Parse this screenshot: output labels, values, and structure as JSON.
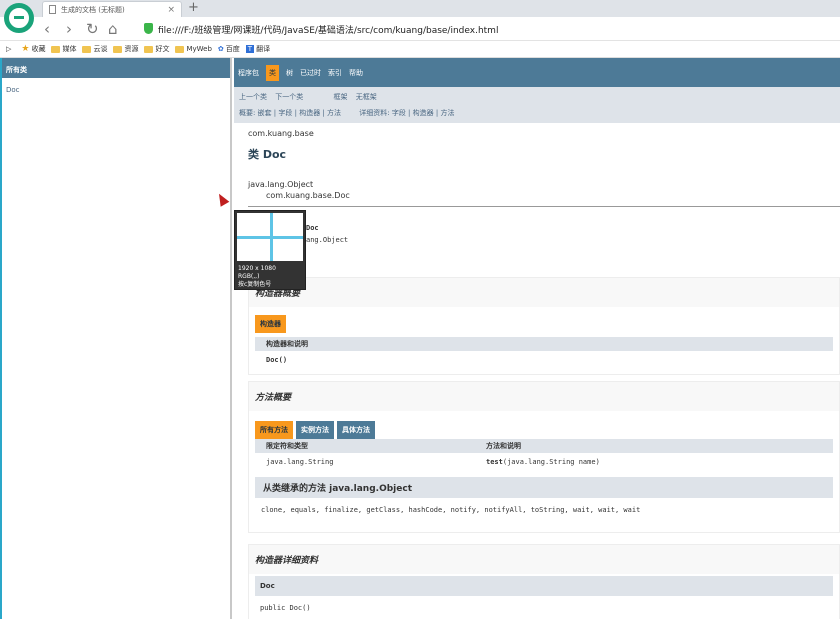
{
  "tab": {
    "title": "生成的文档 (无标题)",
    "close": "×",
    "new_tab": "+"
  },
  "address": {
    "url": "file:///F:/班级管理/网课班/代码/JavaSE/基础语法/src/com/kuang/base/index.html"
  },
  "bookmarks": [
    {
      "label": "收藏",
      "icon": "star-icon"
    },
    {
      "label": "媒体",
      "icon": "folder-icon"
    },
    {
      "label": "云谈",
      "icon": "folder-icon"
    },
    {
      "label": "资源",
      "icon": "folder-icon"
    },
    {
      "label": "好文",
      "icon": "folder-icon"
    },
    {
      "label": "MyWeb",
      "icon": "folder-icon"
    },
    {
      "label": "百度",
      "icon": "baidu-icon"
    },
    {
      "label": "翻译",
      "icon": "translate-icon"
    }
  ],
  "left_frame": {
    "header": "所有类",
    "item": "Doc"
  },
  "topnav": {
    "items": [
      "程序包",
      "类",
      "树",
      "已过时",
      "索引",
      "帮助"
    ]
  },
  "subnav": {
    "prev": "上一个类",
    "next": "下一个类",
    "frames": "框架",
    "no_frames": "无框架",
    "summary": "概要: 嵌套 | 字段 | 构造器 | 方法",
    "detail": "详细资料: 字段 | 构造器 | 方法"
  },
  "header": {
    "package": "com.kuang.base",
    "title": "类 Doc",
    "inherit_parent": "java.lang.Object",
    "inherit_child": "com.kuang.base.Doc"
  },
  "declaration": {
    "line1": "Doc",
    "line2": "ang.Object"
  },
  "constructor_summary": {
    "title": "构造器概要",
    "caption": "构造器",
    "col": "构造器和说明",
    "row": "Doc()"
  },
  "method_summary": {
    "title": "方法概要",
    "tabs": [
      "所有方法",
      "实例方法",
      "具体方法"
    ],
    "col1": "限定符和类型",
    "col2": "方法和说明",
    "row_type": "java.lang.String",
    "row_method": "test",
    "row_params": "(java.lang.String name)",
    "inherited_title": "从类继承的方法 java.lang.Object",
    "inherited_list": "clone, equals, finalize, getClass, hashCode, notify, notifyAll, toString, wait, wait, wait"
  },
  "constructor_detail": {
    "title": "构造器详细资料",
    "name": "Doc",
    "signature": "public Doc()"
  },
  "color_picker": {
    "line1": "1920 x 1080",
    "line2": "RGB(,,)",
    "line3": "按c复制色号",
    "crosshair_color": "#5ec4e6"
  },
  "colors": {
    "accent": "#4d7a97",
    "active": "#f8981d"
  }
}
